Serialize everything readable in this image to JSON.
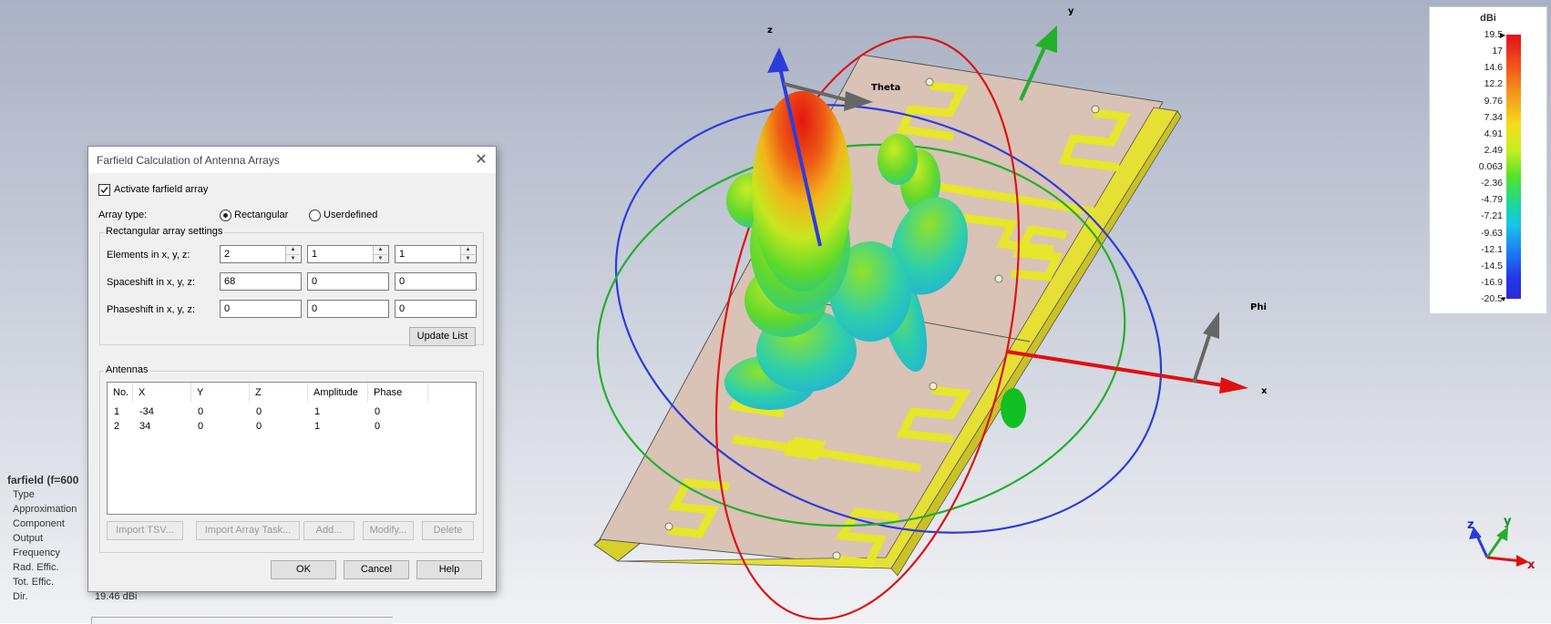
{
  "viewport": {
    "background_top": "#a9b1c4",
    "axes": {
      "x": "x",
      "y": "y",
      "z": "z",
      "theta": "Theta",
      "phi": "Phi"
    },
    "colors": {
      "x_axis": "#e01010",
      "y_axis": "#22b02a",
      "z_axis": "#2a3ddb",
      "board": "#d8c0b4",
      "trace": "#e6e62a"
    }
  },
  "legend": {
    "unit": "dBi",
    "ticks": [
      "19.5",
      "17",
      "14.6",
      "12.2",
      "9.76",
      "7.34",
      "4.91",
      "2.49",
      "0.063",
      "-2.36",
      "-4.79",
      "-7.21",
      "-9.63",
      "-12.1",
      "-14.5",
      "-16.9",
      "-20.5"
    ]
  },
  "info": {
    "title": "farfield (f=600",
    "rows": [
      {
        "k": "Type",
        "v": ""
      },
      {
        "k": "Approximation",
        "v": ""
      },
      {
        "k": "Component",
        "v": ""
      },
      {
        "k": "Output",
        "v": ""
      },
      {
        "k": "Frequency",
        "v": ""
      },
      {
        "k": "Rad. Effic.",
        "v": ""
      },
      {
        "k": "Tot. Effic.",
        "v": ""
      },
      {
        "k": "Dir.",
        "v": "19.46 dBi"
      }
    ]
  },
  "dialog": {
    "title": "Farfield Calculation of Antenna Arrays",
    "close": "✕",
    "activate_label": "Activate farfield array",
    "activate_checked": true,
    "array_type_label": "Array type:",
    "array_type_options": [
      "Rectangular",
      "Userdefined"
    ],
    "array_type_selected": "Rectangular",
    "rect_group_label": "Rectangular array settings",
    "elements_label": "Elements in x, y, z:",
    "elements": [
      "2",
      "1",
      "1"
    ],
    "spaceshift_label": "Spaceshift in x, y, z:",
    "spaceshift": [
      "68",
      "0",
      "0"
    ],
    "phaseshift_label": "Phaseshift in x, y, z:",
    "phaseshift": [
      "0",
      "0",
      "0"
    ],
    "update_label": "Update List",
    "antennas_label": "Antennas",
    "table": {
      "columns": [
        "No.",
        "X",
        "Y",
        "Z",
        "Amplitude",
        "Phase"
      ],
      "rows": [
        [
          "1",
          "-34",
          "0",
          "0",
          "1",
          "0"
        ],
        [
          "2",
          "34",
          "0",
          "0",
          "1",
          "0"
        ]
      ]
    },
    "buttons": {
      "import_tsv": "Import TSV...",
      "import_array": "Import Array Task...",
      "add": "Add...",
      "modify": "Modify...",
      "delete": "Delete",
      "ok": "OK",
      "cancel": "Cancel",
      "help": "Help"
    }
  }
}
